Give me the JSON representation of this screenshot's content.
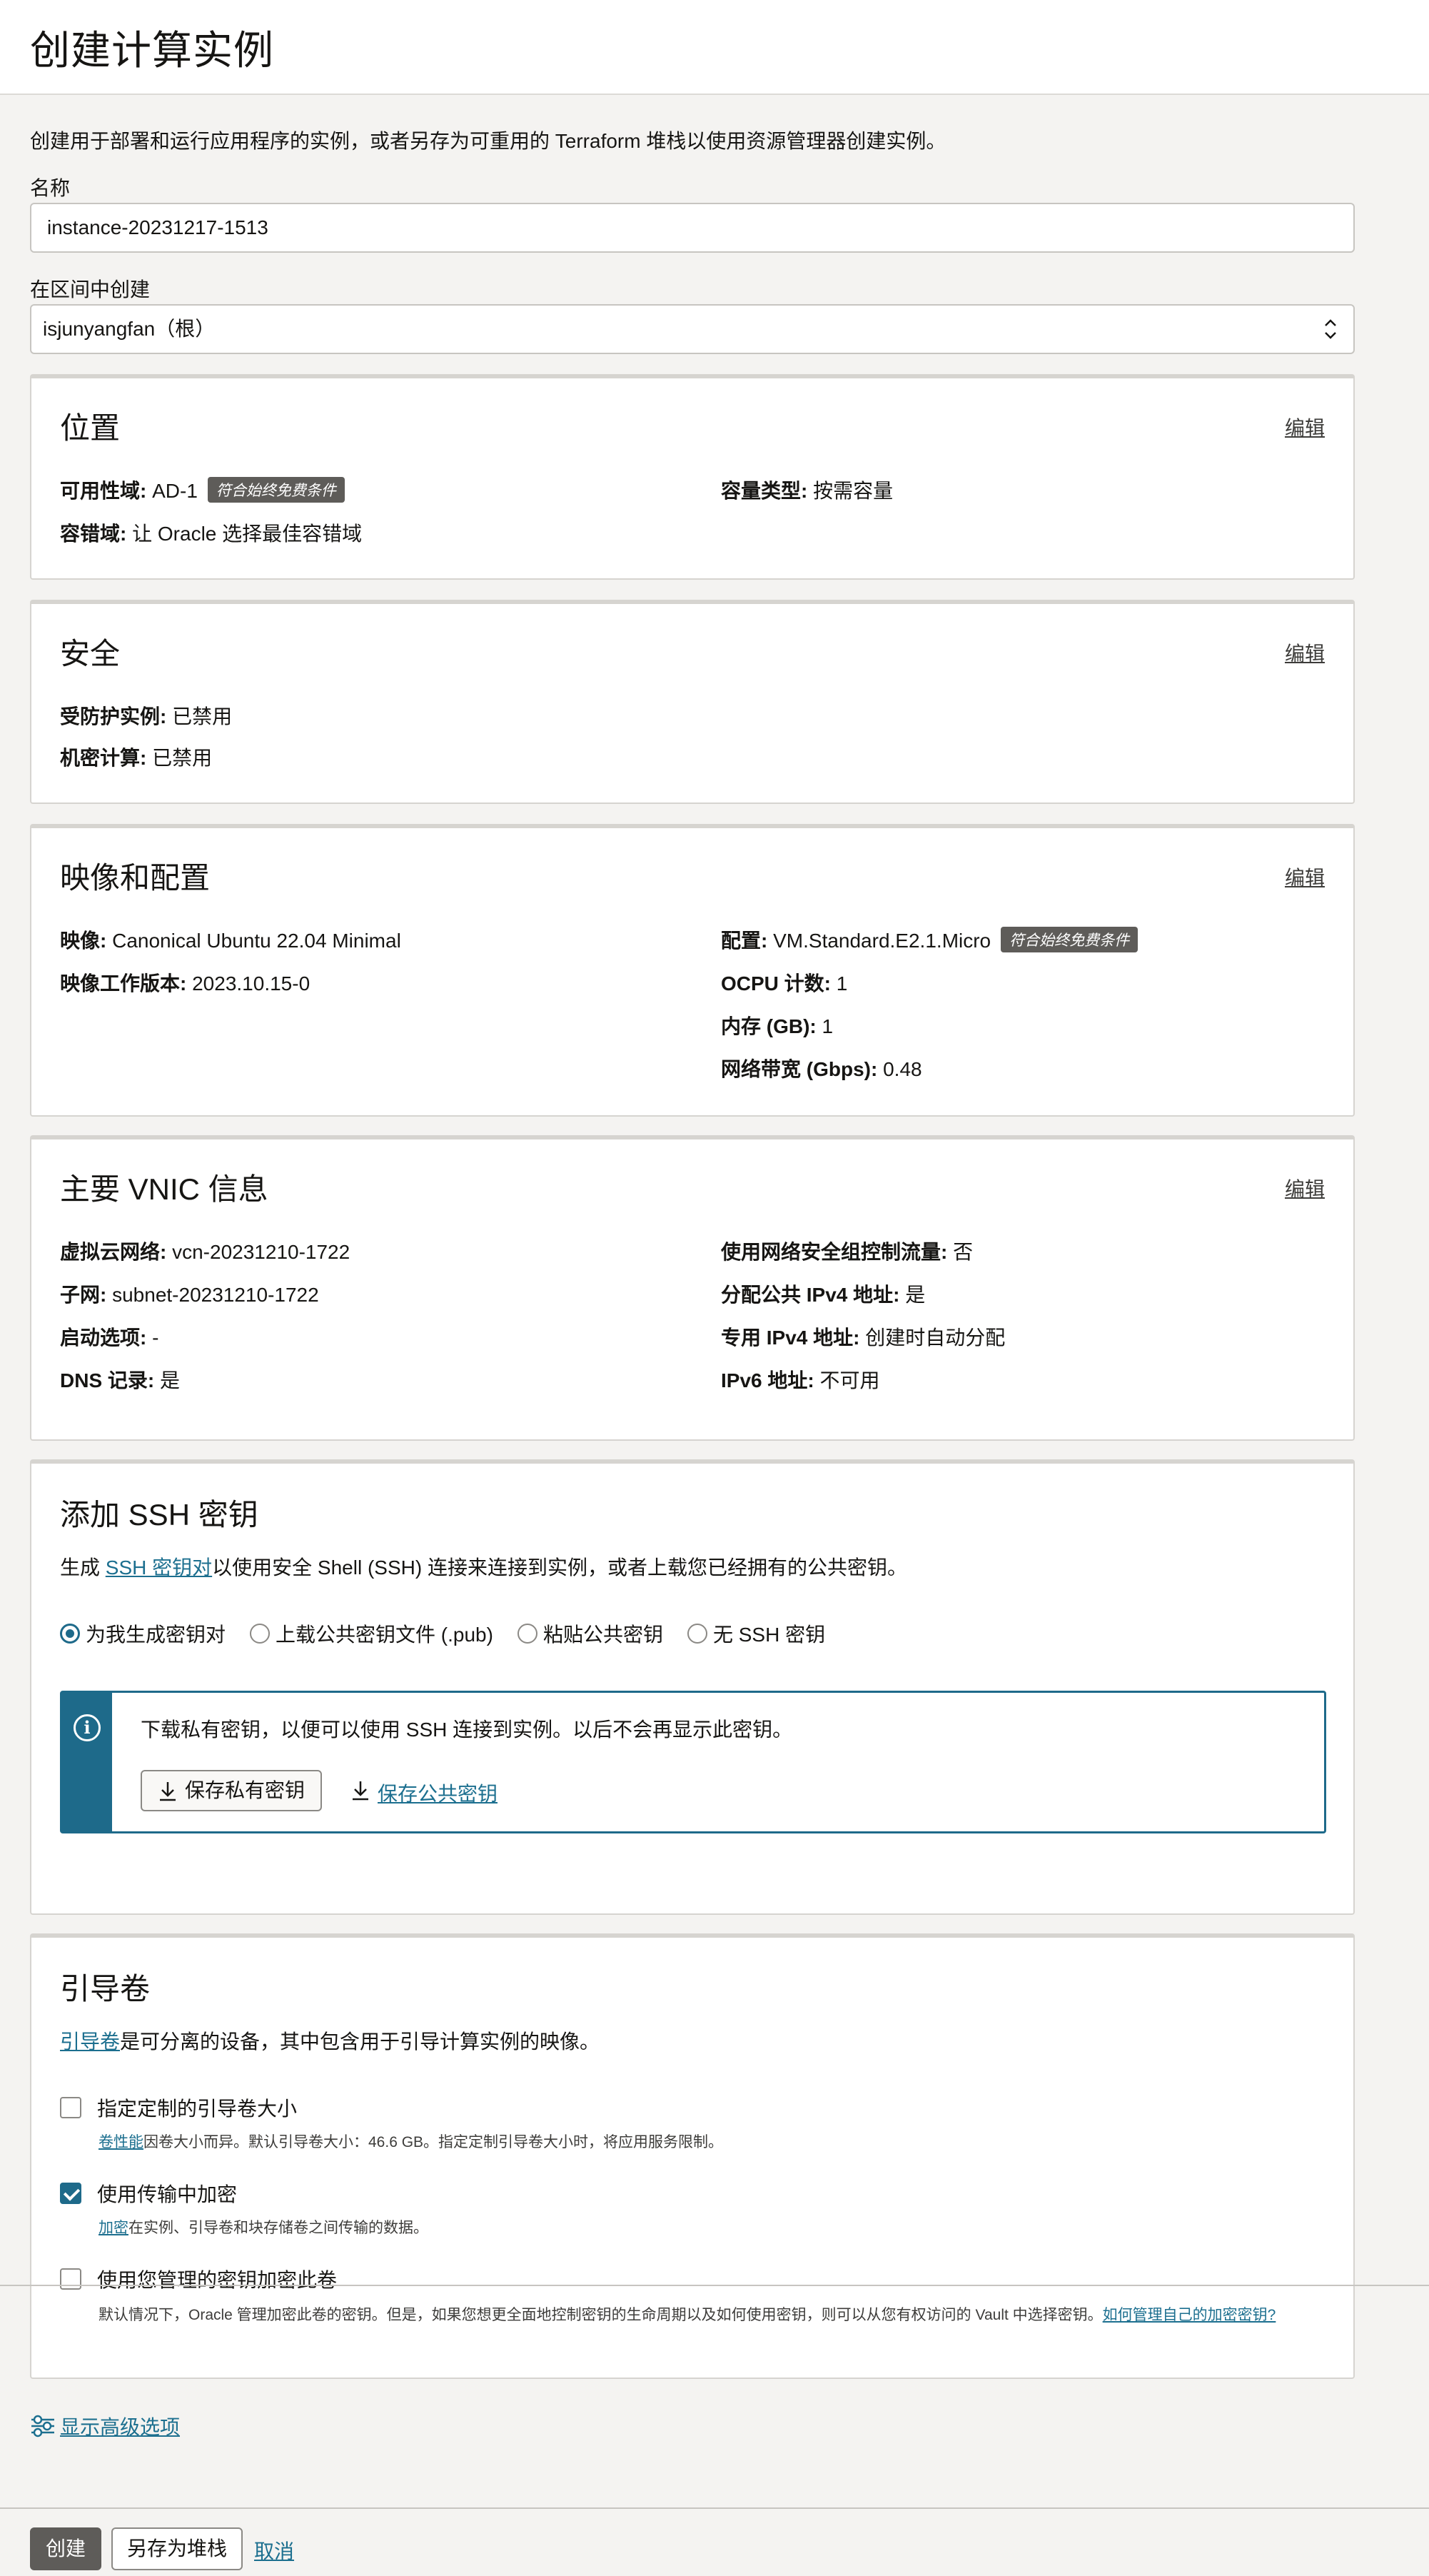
{
  "page": {
    "title": "创建计算实例",
    "intro": "创建用于部署和运行应用程序的实例，或者另存为可重用的 Terraform 堆栈以使用资源管理器创建实例。"
  },
  "name_field": {
    "label": "名称",
    "value": "instance-20231217-1513"
  },
  "compartment_field": {
    "label": "在区间中创建",
    "value": "isjunyangfan（根）"
  },
  "edit_label": "编辑",
  "placement": {
    "title": "位置",
    "ad_label": "可用性域:",
    "ad_value": "AD-1",
    "ad_badge": "符合始终免费条件",
    "capacity_label": "容量类型:",
    "capacity_value": "按需容量",
    "fd_label": "容错域:",
    "fd_value": "让 Oracle 选择最佳容错域"
  },
  "security": {
    "title": "安全",
    "shielded_label": "受防护实例:",
    "shielded_value": "已禁用",
    "confidential_label": "机密计算:",
    "confidential_value": "已禁用"
  },
  "image_shape": {
    "title": "映像和配置",
    "image_label": "映像:",
    "image_value": "Canonical Ubuntu 22.04 Minimal",
    "build_label": "映像工作版本:",
    "build_value": "2023.10.15-0",
    "shape_label": "配置:",
    "shape_value": "VM.Standard.E2.1.Micro",
    "shape_badge": "符合始终免费条件",
    "ocpu_label": "OCPU 计数:",
    "ocpu_value": "1",
    "memory_label": "内存 (GB):",
    "memory_value": "1",
    "bandwidth_label": "网络带宽 (Gbps):",
    "bandwidth_value": "0.48"
  },
  "vnic": {
    "title": "主要 VNIC 信息",
    "vcn_label": "虚拟云网络:",
    "vcn_value": "vcn-20231210-1722",
    "subnet_label": "子网:",
    "subnet_value": "subnet-20231210-1722",
    "launch_label": "启动选项:",
    "launch_value": "-",
    "dns_label": "DNS 记录:",
    "dns_value": "是",
    "nsg_label": "使用网络安全组控制流量:",
    "nsg_value": "否",
    "public_ip_label": "分配公共 IPv4 地址:",
    "public_ip_value": "是",
    "private_ip_label": "专用 IPv4 地址:",
    "private_ip_value": "创建时自动分配",
    "ipv6_label": "IPv6 地址:",
    "ipv6_value": "不可用"
  },
  "ssh": {
    "title": "添加 SSH 密钥",
    "desc_prefix": "生成 ",
    "desc_link": "SSH 密钥对",
    "desc_suffix": "以使用安全 Shell (SSH) 连接来连接到实例，或者上载您已经拥有的公共密钥。",
    "options": [
      "为我生成密钥对",
      "上载公共密钥文件 (.pub)",
      "粘贴公共密钥",
      "无 SSH 密钥"
    ],
    "selected_index": 0,
    "info_text": "下载私有密钥，以便可以使用 SSH 连接到实例。以后不会再显示此密钥。",
    "save_private": "保存私有密钥",
    "save_public": "保存公共密钥"
  },
  "boot": {
    "title": "引导卷",
    "desc_link": "引导卷",
    "desc_suffix": "是可分离的设备，其中包含用于引导计算实例的映像。",
    "custom_size_label": "指定定制的引导卷大小",
    "custom_size_checked": false,
    "custom_size_help_link": "卷性能",
    "custom_size_help": "因卷大小而异。默认引导卷大小：46.6 GB。指定定制引导卷大小时，将应用服务限制。",
    "transit_label": "使用传输中加密",
    "transit_checked": true,
    "transit_help_link": "加密",
    "transit_help": "在实例、引导卷和块存储卷之间传输的数据。",
    "own_key_label": "使用您管理的密钥加密此卷",
    "own_key_checked": false,
    "own_key_help": "默认情况下，Oracle 管理加密此卷的密钥。但是，如果您想更全面地控制密钥的生命周期以及如何使用密钥，则可以从您有权访问的 Vault 中选择密钥。",
    "own_key_help_link": "如何管理自己的加密密钥?"
  },
  "advanced_label": "显示高级选项",
  "footer": {
    "create": "创建",
    "save_stack": "另存为堆栈",
    "cancel": "取消"
  }
}
